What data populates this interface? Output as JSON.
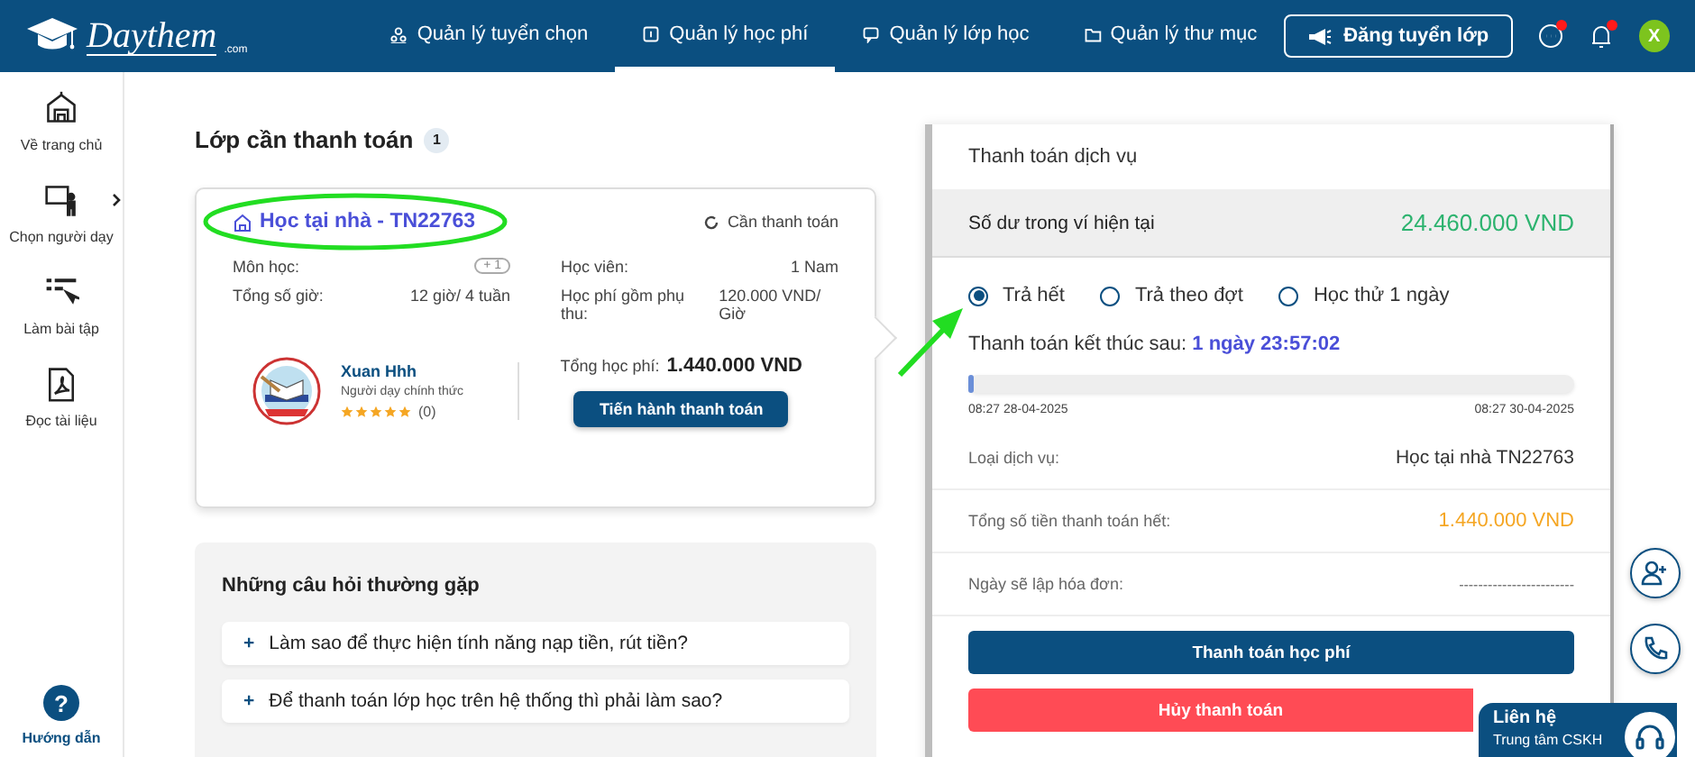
{
  "header": {
    "logo": {
      "name": "Daythem",
      "suffix": ".com"
    },
    "nav": [
      {
        "label": "Quản lý tuyển chọn",
        "selected": false
      },
      {
        "label": "Quản lý học phí",
        "selected": true
      },
      {
        "label": "Quản lý lớp học",
        "selected": false
      },
      {
        "label": "Quản lý thư mục",
        "selected": false
      }
    ],
    "post_button": "Đăng tuyển lớp",
    "messages_unread": true,
    "notifications_unread": true,
    "avatar": "X"
  },
  "sidebar": {
    "items": [
      {
        "label": "Về trang chủ",
        "expandable": false
      },
      {
        "label": "Chọn người dạy",
        "expandable": true
      },
      {
        "label": "Làm bài tập",
        "expandable": false
      },
      {
        "label": "Đọc tài liệu",
        "expandable": false
      }
    ],
    "help": {
      "icon": "?",
      "label": "Hướng dẫn"
    }
  },
  "classes": {
    "title": "Lớp cần thanh toán",
    "count": "1",
    "card": {
      "title": "Học tại nhà - TN22763",
      "status": "Cần thanh toán",
      "fields": [
        {
          "label": "Môn học:",
          "value": "+ 1",
          "kind": "badge"
        },
        {
          "label": "Học viên:",
          "value": "1 Nam",
          "kind": "text"
        },
        {
          "label": "Tổng số giờ:",
          "value": "12 giờ/ 4 tuần",
          "kind": "text"
        },
        {
          "label": "Học phí gồm phụ thu:",
          "value": "120.000 VND/ Giờ",
          "kind": "text"
        }
      ],
      "teacher": {
        "name": "Xuan Hhh",
        "role": "Người dạy chính thức",
        "stars": 5,
        "reviews": "(0)"
      },
      "total_label": "Tổng học phí:",
      "total": "1.440.000 VND",
      "pay_button": "Tiến hành thanh toán"
    }
  },
  "faq": {
    "title": "Những câu hỏi thường gặp",
    "items": [
      {
        "icon": "+",
        "question": "Làm sao để thực hiện tính năng nạp tiền, rút tiền?"
      },
      {
        "icon": "+",
        "question": "Để thanh toán lớp học trên hệ thống thì phải làm sao?"
      }
    ]
  },
  "payment": {
    "title": "Thanh toán dịch vụ",
    "balance_label": "Số dư trong ví hiện tại",
    "balance": "24.460.000 VND",
    "options": [
      {
        "label": "Trả hết",
        "selected": true
      },
      {
        "label": "Trả theo đợt",
        "selected": false
      },
      {
        "label": "Học thử 1 ngày",
        "selected": false
      }
    ],
    "deadline_label": "Thanh toán kết thúc sau:",
    "deadline": "1 ngày 23:57:02",
    "progress": {
      "level": 0.01,
      "start": "08:27 28-04-2025",
      "end": "08:27 30-04-2025"
    },
    "rows": [
      {
        "label": "Loại dịch vụ:",
        "value": "Học tại nhà TN22763",
        "kind": "plain"
      },
      {
        "label": "Tổng số tiền thanh toán hết:",
        "value": "1.440.000 VND",
        "kind": "amount"
      },
      {
        "label": "Ngày sẽ lập hóa đơn:",
        "value": "------------------------",
        "kind": "empty"
      }
    ],
    "buttons": [
      {
        "label": "Thanh toán học phí",
        "kind": "primary"
      },
      {
        "label": "Hủy thanh toán",
        "kind": "danger"
      }
    ]
  },
  "contact": {
    "title": "Liên hệ",
    "subtitle": "Trung tâm CSKH"
  }
}
